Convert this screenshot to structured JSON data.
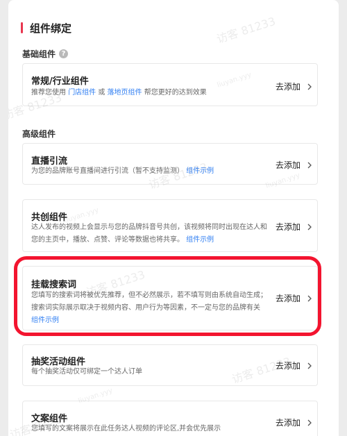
{
  "section": {
    "title": "组件绑定"
  },
  "basic": {
    "label": "基础组件",
    "help_icon": "?",
    "card": {
      "title": "常规/行业组件",
      "desc_1": "推荐您使用 ",
      "link_1": "门店组件",
      "desc_2": " 或 ",
      "link_2": "落地页组件",
      "desc_3": " 帮您更好的达到效果",
      "add": "去添加"
    }
  },
  "advanced": {
    "label": "高级组件",
    "live": {
      "title": "直播引流",
      "desc": "为您的品牌账号直播间进行引流（暂不支持监测）",
      "link": "组件示例",
      "add": "去添加"
    },
    "cocreate": {
      "title": "共创组件",
      "desc": "达人发布的视频上会显示与您的品牌抖音号共创，该视频将同时出现在达人和您的主页中，播放、点赞、评论等数据也将共享。",
      "link": "组件示例",
      "add": "去添加"
    },
    "search": {
      "title": "挂载搜索词",
      "desc": "您填写的搜索词将被优先推荐，但不必然展示，若不填写则由系统自动生成；搜索词实际展示取决于视频内容、用户行为等因素，不一定与您的品牌有关",
      "link": "组件示例",
      "add": "去添加"
    },
    "lottery": {
      "title": "抽奖活动组件",
      "desc": "每个抽奖活动仅可绑定一个达人订单",
      "add": "去添加"
    },
    "copy": {
      "title": "文案组件",
      "desc": "您填写的文案将展示在此任务达人视频的评论区,并会优先展示",
      "add": "去添加"
    }
  },
  "watermark": {
    "big": "访客 81233",
    "small": "liuyan.yyy"
  }
}
